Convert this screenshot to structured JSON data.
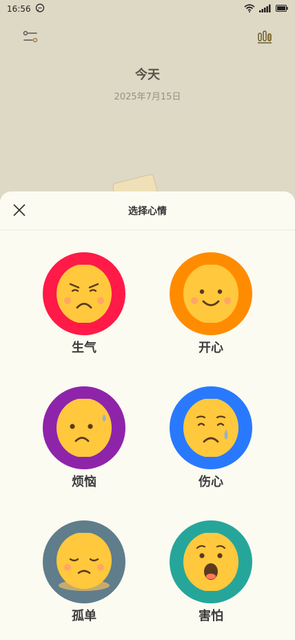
{
  "status_bar": {
    "time": "16:56",
    "icons": [
      "chat-notification-icon",
      "wifi-icon",
      "signal-icon",
      "battery-icon"
    ]
  },
  "top_bar": {
    "left_icon": "filter-sliders-icon",
    "right_icon": "bar-chart-icon"
  },
  "day": {
    "heading": "今天",
    "date": "2025年7月15日"
  },
  "sheet": {
    "title": "选择心情",
    "close_icon": "close-icon"
  },
  "moods": [
    {
      "label": "生气",
      "color": "#ff1a47",
      "face": "angry"
    },
    {
      "label": "开心",
      "color": "#ff8c00",
      "face": "happy"
    },
    {
      "label": "烦恼",
      "color": "#8e24aa",
      "face": "worried"
    },
    {
      "label": "伤心",
      "color": "#2979ff",
      "face": "sad"
    },
    {
      "label": "孤单",
      "color": "#607d8b",
      "face": "lonely"
    },
    {
      "label": "害怕",
      "color": "#26a69a",
      "face": "scared"
    }
  ],
  "colors": {
    "background": "#ddd9c5",
    "sheet": "#fcfbf2",
    "face": "#ffc83d"
  }
}
